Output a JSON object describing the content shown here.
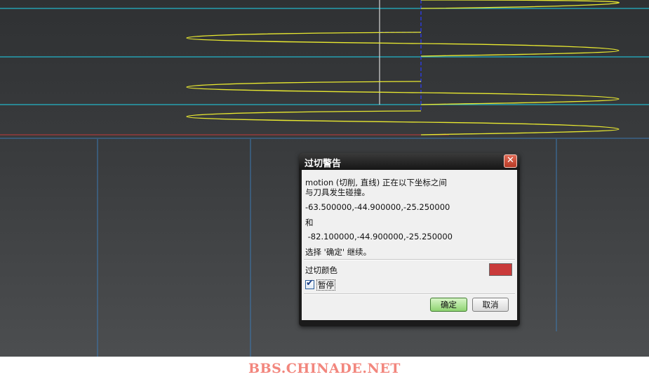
{
  "viewport": {
    "colors": {
      "background_top": "#2f3133",
      "background_bottom": "#4c4e50",
      "toolpath": "#e8e830",
      "stock_boundary": "#23b4c8",
      "axis_white": "#d8d8d8",
      "axis_blue": "#2c3cff",
      "grid_line": "#3b78b0",
      "edge_red": "#c23a3a"
    }
  },
  "dialog": {
    "title": "过切警告",
    "close_glyph": "✕",
    "message_line1": "motion (切削, 直线) 正在以下坐标之间",
    "message_line2": "与刀具发生碰撞。",
    "coordinate_start": "-63.500000,-44.900000,-25.250000",
    "connector": "和",
    "coordinate_end": " -82.100000,-44.900000,-25.250000",
    "instruction": "选择 '确定' 继续。",
    "cut_color_label": "过切颜色",
    "cut_color_value": "#c93a3a",
    "pause_label": "暂停",
    "pause_checked": true,
    "ok_label": "确定",
    "cancel_label": "取消"
  },
  "watermark": {
    "text": "BBS.CHINADE.NET"
  }
}
